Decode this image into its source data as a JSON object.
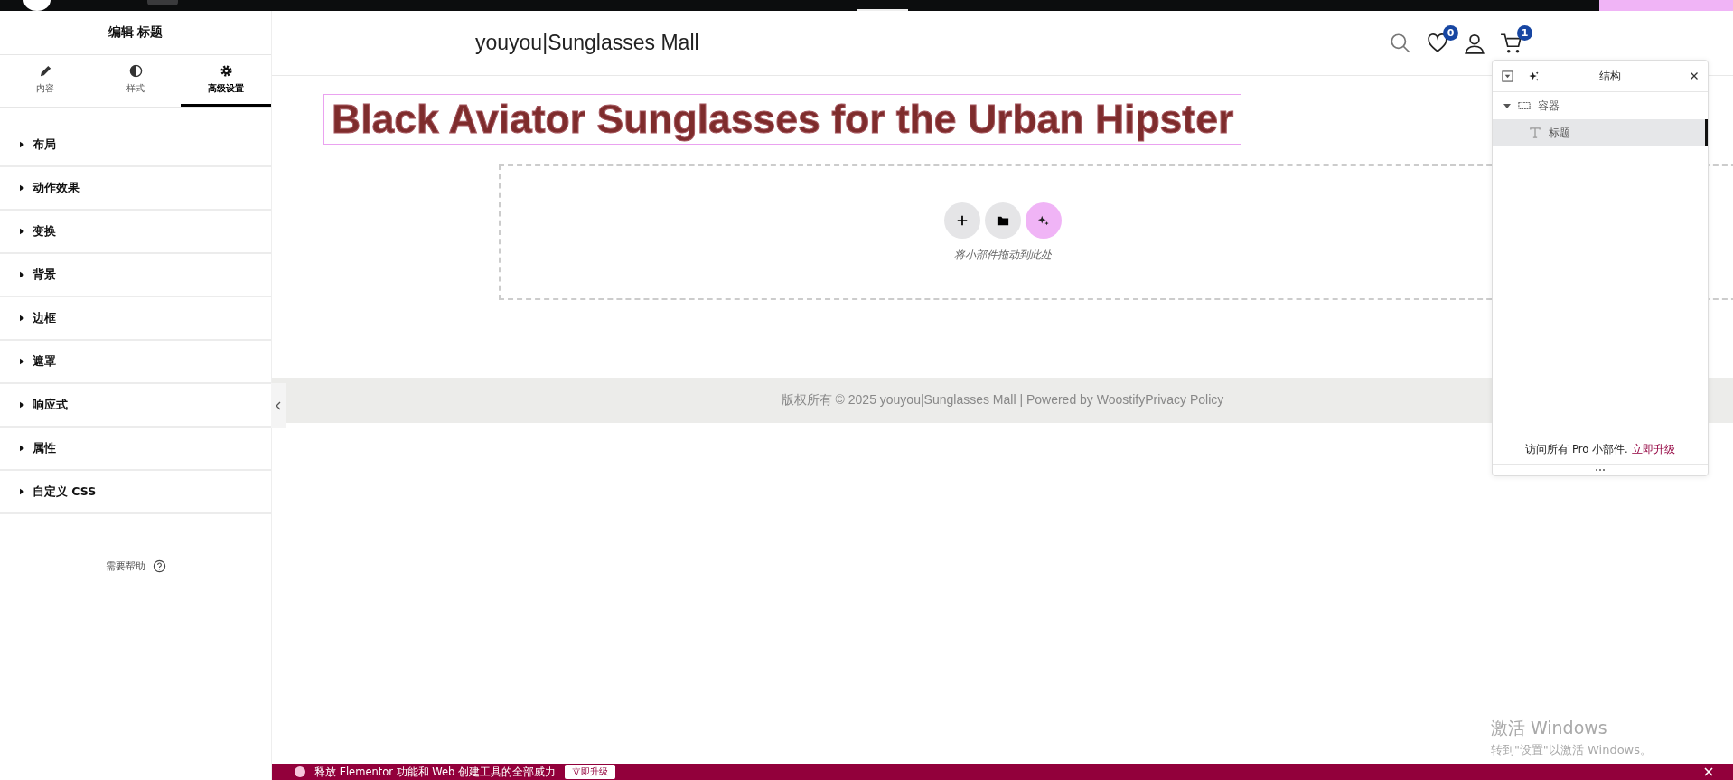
{
  "panel": {
    "title": "编辑 标题",
    "tabs": [
      {
        "label": "内容",
        "selected": false
      },
      {
        "label": "样式",
        "selected": false
      },
      {
        "label": "高级设置",
        "selected": true
      }
    ],
    "sections": [
      {
        "label": "布局",
        "expanded": false
      },
      {
        "label": "动作效果",
        "expanded": false
      },
      {
        "label": "变换",
        "expanded": false
      },
      {
        "label": "背景",
        "expanded": false
      },
      {
        "label": "边框",
        "expanded": false
      },
      {
        "label": "遮罩",
        "expanded": false
      },
      {
        "label": "响应式",
        "expanded": false
      },
      {
        "label": "属性",
        "expanded": false
      },
      {
        "label": "自定义 CSS",
        "expanded": false
      }
    ],
    "help": "需要帮助"
  },
  "site": {
    "title": "youyou|Sunglasses Mall",
    "wishlist_count": "0",
    "cart_count": "1"
  },
  "heading": "Black Aviator Sunglasses for the Urban Hipster",
  "drop_zone": {
    "hint": "将小部件拖动到此处"
  },
  "footer": "版权所有 © 2025 youyou|Sunglasses Mall | Powered by WoostifyPrivacy Policy",
  "structure": {
    "title": "结构",
    "tree": [
      {
        "label": "容器",
        "expanded": true,
        "selected": false,
        "children": [
          {
            "label": "标题",
            "selected": true
          }
        ]
      }
    ],
    "promo": "访问所有 Pro 小部件.",
    "promo_link": "立即升级"
  },
  "notice": {
    "text": "释放 Elementor 功能和 Web 创建工具的全部威力",
    "button": "立即升级"
  },
  "activation": {
    "title": "激活 Windows",
    "text": "转到\"设置\"以激活 Windows。"
  }
}
